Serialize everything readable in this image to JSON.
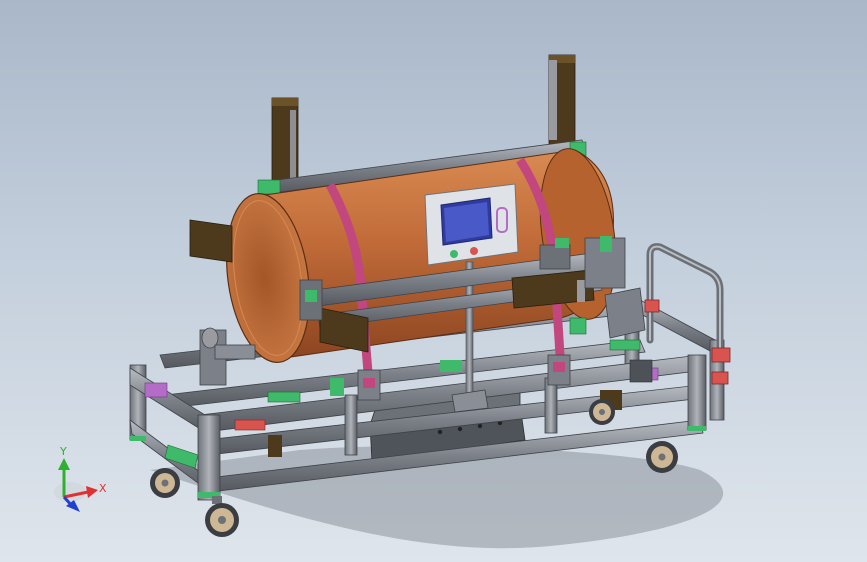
{
  "view": {
    "background_top": "#a9b7c9",
    "background_bottom": "#dfe5ec"
  },
  "model": {
    "tank_color": "#c06a38",
    "strap_color": "#c2477e",
    "frame_color": "#8a8e96",
    "frame_dark": "#4d5158",
    "clamp_color": "#4d3a1c",
    "green_part": "#3fb96a",
    "purple_part": "#b36dc7",
    "hmi_screen": "#4a59c8"
  },
  "triad": {
    "x_label": "X",
    "y_label": "Y",
    "x_color": "#e03030",
    "y_color": "#30b030",
    "z_color": "#2040d0"
  }
}
